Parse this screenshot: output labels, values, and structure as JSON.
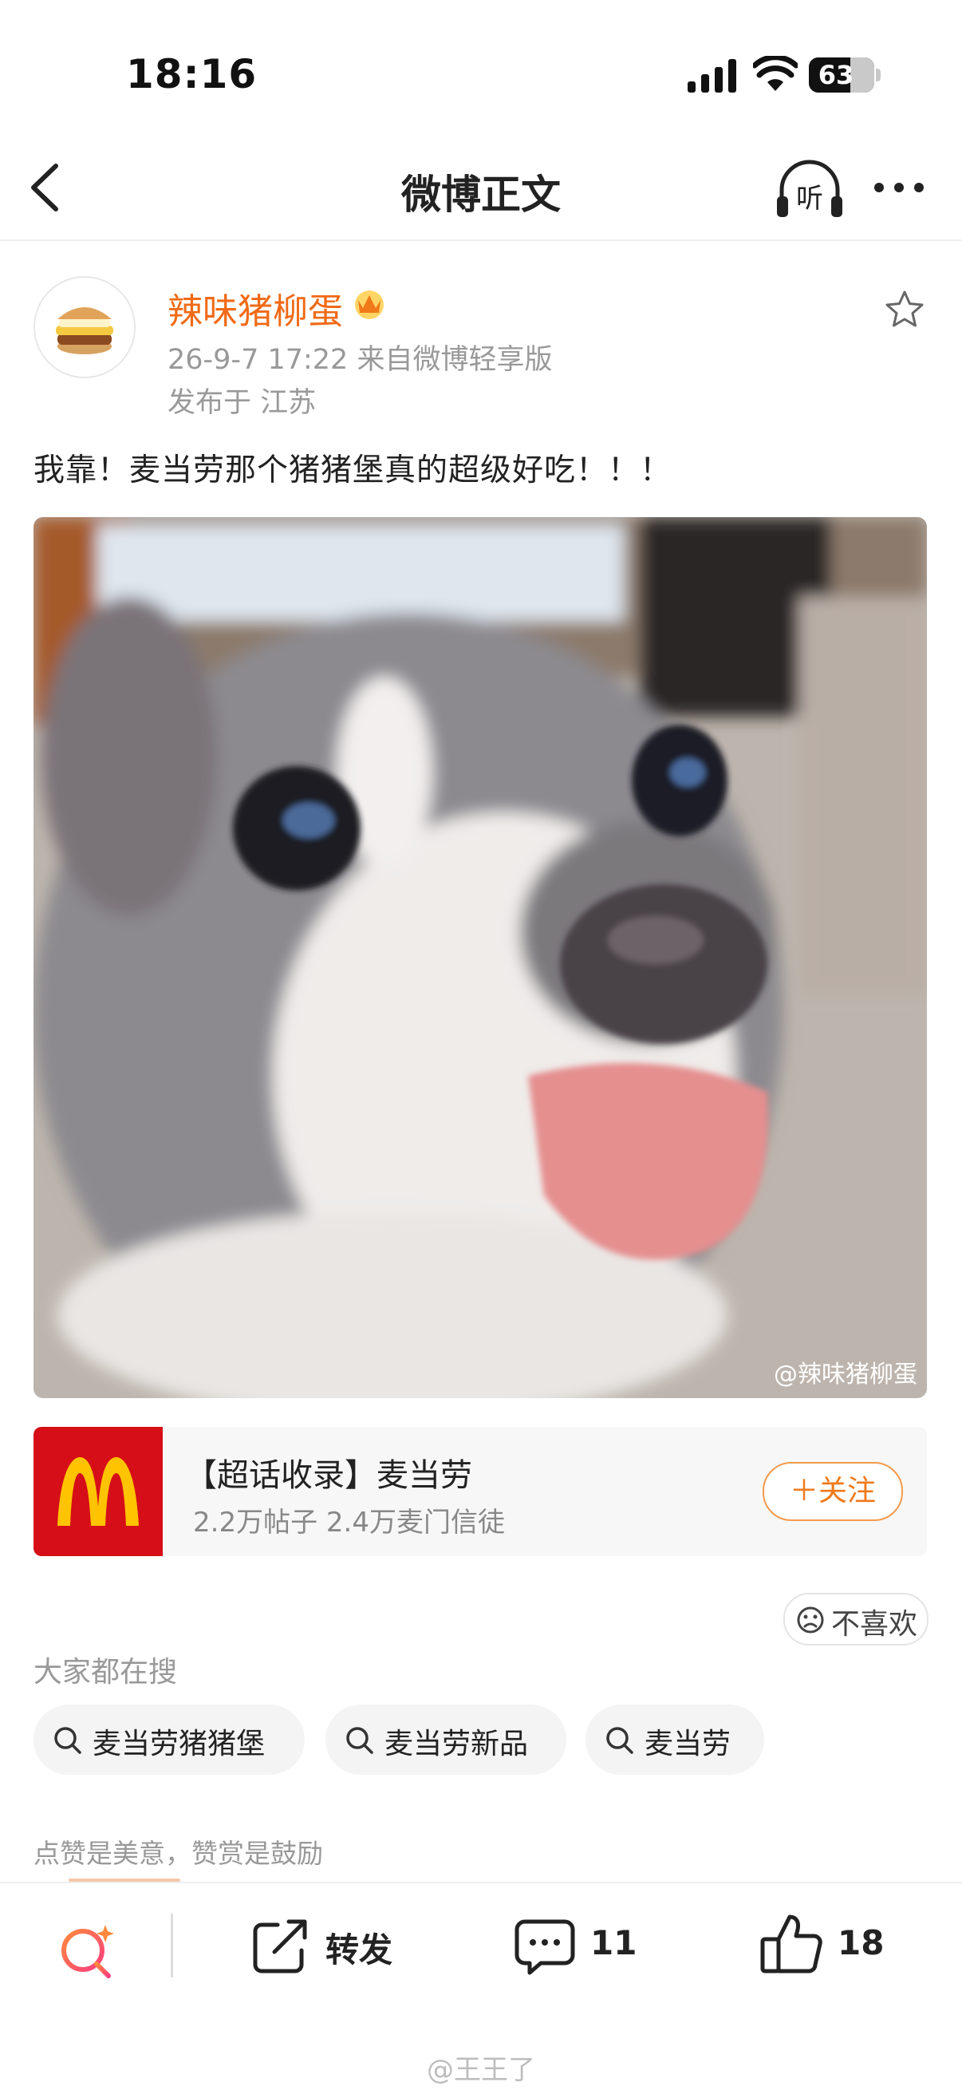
{
  "status_bar": {
    "time": "18:16",
    "battery": "63",
    "battery_level": 0.63
  },
  "nav": {
    "title": "微博正文",
    "listen_icon_text": "听"
  },
  "post": {
    "author": "辣味猪柳蛋",
    "meta": "26-9-7 17:22  来自微博轻享版",
    "location": "发布于 江苏",
    "text": "我靠！麦当劳那个猪猪堡真的超级好吃！！！",
    "image_watermark": "@辣味猪柳蛋"
  },
  "topic_card": {
    "title": "【超话收录】麦当劳",
    "stats": "2.2万帖子  2.4万麦门信徒",
    "follow_label": "＋关注"
  },
  "dislike_label": "不喜欢",
  "search": {
    "heading": "大家都在搜",
    "chips": [
      "麦当劳猪猪堡",
      "麦当劳新品",
      "麦当劳"
    ]
  },
  "reward_note": "点赞是美意，赞赏是鼓励",
  "actions": {
    "share_label": "转发",
    "comments": "11",
    "likes": "18"
  },
  "bottom_watermark": "@王王了",
  "colors": {
    "accent": "#f06a16",
    "mcdonalds_red": "#d60e17",
    "mcdonalds_yellow": "#ffc300"
  }
}
